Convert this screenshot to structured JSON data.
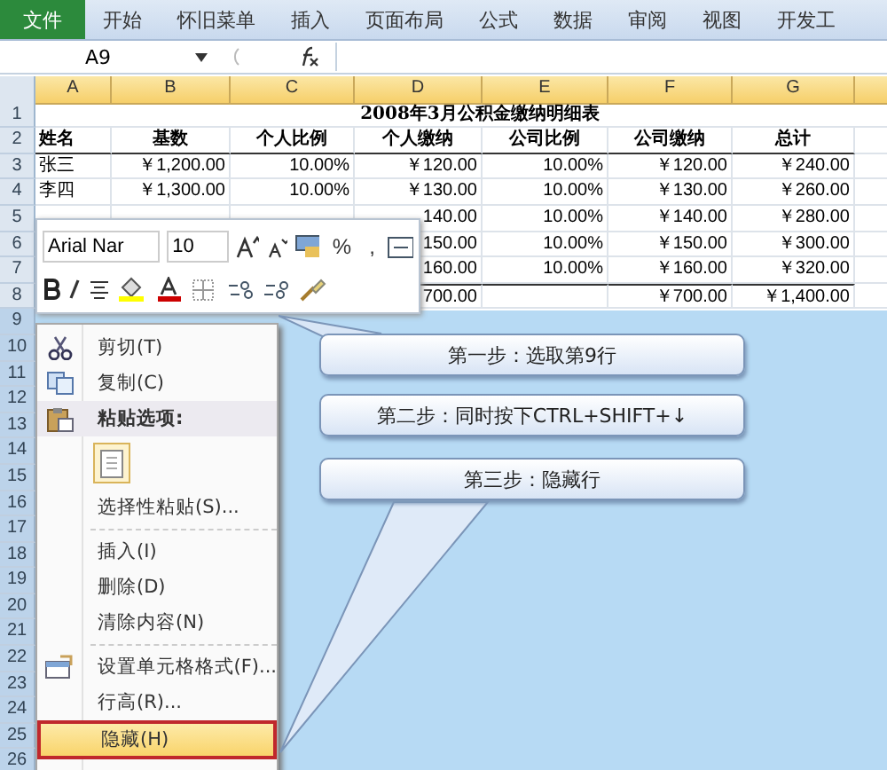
{
  "ribbon": {
    "tabs": [
      {
        "label": "文件",
        "selected": true
      },
      {
        "label": "开始",
        "selected": false
      },
      {
        "label": "怀旧菜单",
        "selected": false
      },
      {
        "label": "插入",
        "selected": false
      },
      {
        "label": "页面布局",
        "selected": false
      },
      {
        "label": "公式",
        "selected": false
      },
      {
        "label": "数据",
        "selected": false
      },
      {
        "label": "审阅",
        "selected": false
      },
      {
        "label": "视图",
        "selected": false
      },
      {
        "label": "开发工",
        "selected": false
      }
    ]
  },
  "formula_bar": {
    "name_box": "A9"
  },
  "sheet": {
    "columns": [
      "A",
      "B",
      "C",
      "D",
      "E",
      "F",
      "G"
    ],
    "rows": [
      {
        "number": "1",
        "selected": false,
        "kind": "title",
        "cells": {
          "A": "2008年3月公积金缴纳明细表"
        }
      },
      {
        "number": "2",
        "selected": false,
        "kind": "header",
        "cells": {
          "A": "姓名",
          "B": "基数",
          "C": "个人比例",
          "D": "个人缴纳",
          "E": "公司比例",
          "F": "公司缴纳",
          "G": "总计"
        }
      },
      {
        "number": "3",
        "selected": false,
        "kind": "data",
        "cells": {
          "A": "张三",
          "B": "￥1,200.00",
          "C": "10.00%",
          "D": "￥120.00",
          "E": "10.00%",
          "F": "￥120.00",
          "G": "￥240.00"
        }
      },
      {
        "number": "4",
        "selected": false,
        "kind": "data",
        "cells": {
          "A": "李四",
          "B": "￥1,300.00",
          "C": "10.00%",
          "D": "￥130.00",
          "E": "10.00%",
          "F": "￥130.00",
          "G": "￥260.00"
        }
      },
      {
        "number": "5",
        "selected": false,
        "kind": "data",
        "cells": {
          "D": "140.00",
          "E": "10.00%",
          "F": "￥140.00",
          "G": "￥280.00"
        }
      },
      {
        "number": "6",
        "selected": false,
        "kind": "data",
        "cells": {
          "D": "150.00",
          "E": "10.00%",
          "F": "￥150.00",
          "G": "￥300.00"
        }
      },
      {
        "number": "7",
        "selected": false,
        "kind": "data",
        "cells": {
          "D": "160.00",
          "E": "10.00%",
          "F": "￥160.00",
          "G": "￥320.00"
        }
      },
      {
        "number": "8",
        "selected": false,
        "kind": "total",
        "cells": {
          "D": "700.00",
          "F": "￥700.00",
          "G": "￥1,400.00"
        }
      },
      {
        "number": "9",
        "selected": true,
        "kind": "data",
        "cells": {}
      },
      {
        "number": "10",
        "selected": true,
        "kind": "data",
        "cells": {}
      },
      {
        "number": "11",
        "selected": true,
        "kind": "data",
        "cells": {}
      },
      {
        "number": "12",
        "selected": true,
        "kind": "data",
        "cells": {}
      },
      {
        "number": "13",
        "selected": true,
        "kind": "data",
        "cells": {}
      },
      {
        "number": "14",
        "selected": true,
        "kind": "data",
        "cells": {}
      },
      {
        "number": "15",
        "selected": true,
        "kind": "data",
        "cells": {}
      },
      {
        "number": "16",
        "selected": true,
        "kind": "data",
        "cells": {}
      },
      {
        "number": "17",
        "selected": true,
        "kind": "data",
        "cells": {}
      },
      {
        "number": "18",
        "selected": true,
        "kind": "data",
        "cells": {}
      },
      {
        "number": "19",
        "selected": true,
        "kind": "data",
        "cells": {}
      },
      {
        "number": "20",
        "selected": true,
        "kind": "data",
        "cells": {}
      },
      {
        "number": "21",
        "selected": true,
        "kind": "data",
        "cells": {}
      },
      {
        "number": "22",
        "selected": true,
        "kind": "data",
        "cells": {}
      },
      {
        "number": "23",
        "selected": true,
        "kind": "data",
        "cells": {}
      },
      {
        "number": "24",
        "selected": true,
        "kind": "data",
        "cells": {}
      },
      {
        "number": "25",
        "selected": true,
        "kind": "data",
        "cells": {}
      },
      {
        "number": "26",
        "selected": true,
        "kind": "data",
        "cells": {}
      }
    ]
  },
  "mini_toolbar": {
    "font": "Arial Nar",
    "size": "10",
    "percent": "%",
    "comma": ","
  },
  "context_menu": {
    "items": [
      {
        "kind": "cut",
        "label": "剪切(T)",
        "highlighted": false
      },
      {
        "kind": "copy",
        "label": "复制(C)",
        "highlighted": false
      },
      {
        "kind": "paste-header",
        "label": "粘贴选项:"
      },
      {
        "kind": "paste-option"
      },
      {
        "kind": "item",
        "label": "选择性粘贴(S)...",
        "highlighted": false
      },
      {
        "kind": "separator"
      },
      {
        "kind": "item",
        "label": "插入(I)",
        "highlighted": false
      },
      {
        "kind": "item",
        "label": "删除(D)",
        "highlighted": false
      },
      {
        "kind": "item",
        "label": "清除内容(N)",
        "highlighted": false
      },
      {
        "kind": "separator"
      },
      {
        "kind": "format-cells",
        "label": "设置单元格格式(F)...",
        "highlighted": false
      },
      {
        "kind": "item",
        "label": "行高(R)...",
        "highlighted": false
      },
      {
        "kind": "item",
        "label": "隐藏(H)",
        "highlighted": true
      }
    ]
  },
  "callouts": [
    {
      "text": "第一步：选取第9行"
    },
    {
      "text": "第二步：同时按下CTRL+SHIFT+↓"
    },
    {
      "text": "第三步：隐藏行"
    }
  ]
}
